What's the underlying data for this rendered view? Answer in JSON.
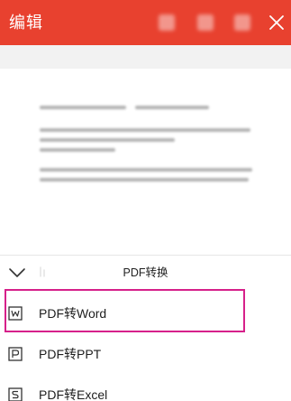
{
  "header": {
    "title": "编辑",
    "close_icon": "close-icon",
    "background": "#e8412f"
  },
  "sheet": {
    "title": "PDF转换",
    "collapse_icon": "chevron-down-icon",
    "items": [
      {
        "label": "PDF转Word",
        "icon": "word-doc-icon",
        "highlighted": true
      },
      {
        "label": "PDF转PPT",
        "icon": "ppt-doc-icon",
        "highlighted": false
      },
      {
        "label": "PDF转Excel",
        "icon": "excel-doc-icon",
        "highlighted": false
      }
    ]
  },
  "colors": {
    "accent": "#e8412f",
    "highlight_box": "#d6208a",
    "text": "#1e1e1e"
  }
}
